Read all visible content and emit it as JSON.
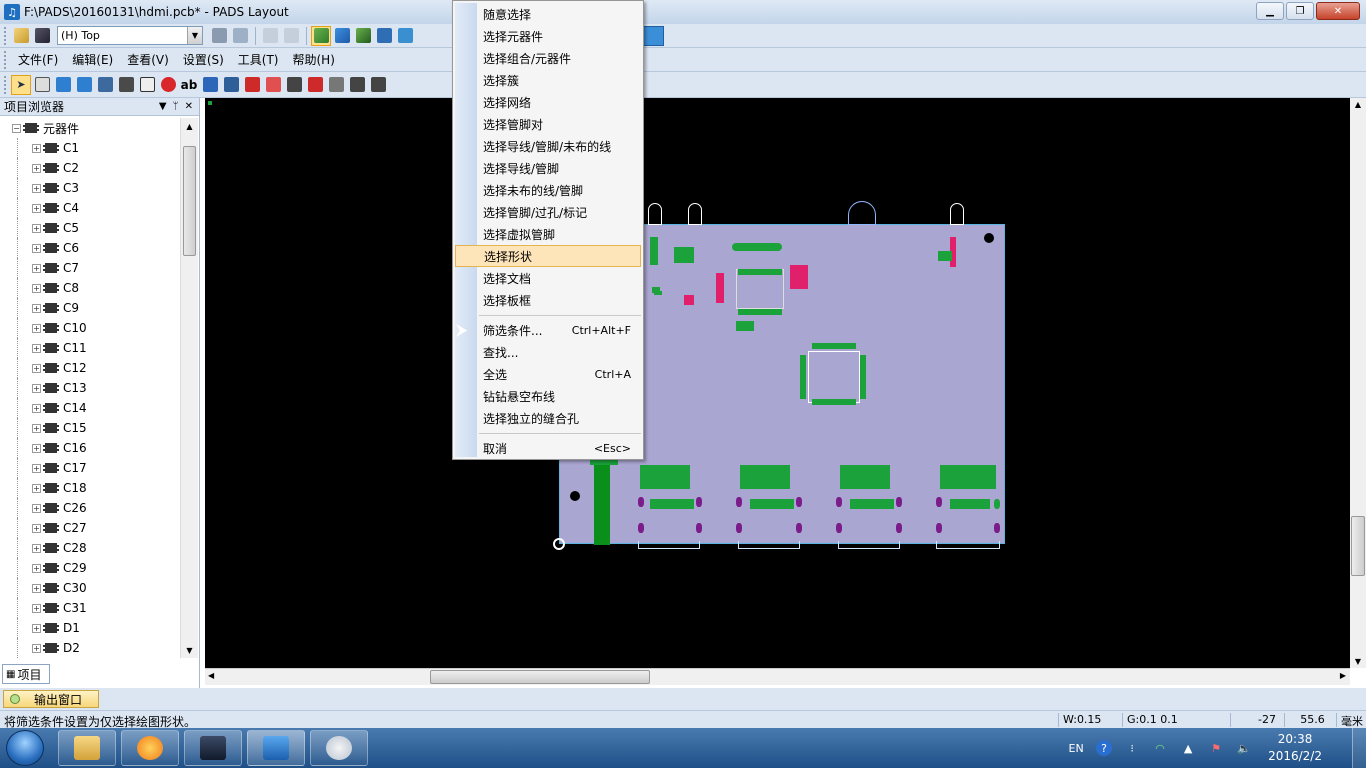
{
  "window": {
    "title": "F:\\PADS\\20160131\\hdmi.pcb* - PADS Layout",
    "minimize": "▁",
    "restore": "❐",
    "close": "✕"
  },
  "toolbar": {
    "layer_select": "(H) Top"
  },
  "menu": [
    "文件(F)",
    "编辑(E)",
    "查看(V)",
    "设置(S)",
    "工具(T)",
    "帮助(H)"
  ],
  "project_browser": {
    "title": "项目浏览器",
    "root": "元器件",
    "items": [
      "C1",
      "C2",
      "C3",
      "C4",
      "C5",
      "C6",
      "C7",
      "C8",
      "C9",
      "C10",
      "C11",
      "C12",
      "C13",
      "C14",
      "C15",
      "C16",
      "C17",
      "C18",
      "C26",
      "C27",
      "C28",
      "C29",
      "C30",
      "C31",
      "D1",
      "D2"
    ],
    "tab": "项目"
  },
  "context_menu": {
    "items": [
      {
        "label": "随意选择"
      },
      {
        "label": "选择元器件"
      },
      {
        "label": "选择组合/元器件"
      },
      {
        "label": "选择簇"
      },
      {
        "label": "选择网络"
      },
      {
        "label": "选择管脚对"
      },
      {
        "label": "选择导线/管脚/未布的线"
      },
      {
        "label": "选择导线/管脚"
      },
      {
        "label": "选择未布的线/管脚"
      },
      {
        "label": "选择管脚/过孔/标记"
      },
      {
        "label": "选择虚拟管脚"
      },
      {
        "label": "选择形状",
        "highlighted": true
      },
      {
        "label": "选择文档"
      },
      {
        "label": "选择板框"
      }
    ],
    "items2": [
      {
        "label": "筛选条件...",
        "shortcut": "Ctrl+Alt+F"
      },
      {
        "label": "查找..."
      },
      {
        "label": "全选",
        "shortcut": "Ctrl+A"
      },
      {
        "label": "钻钻悬空布线"
      },
      {
        "label": "选择独立的缝合孔"
      }
    ],
    "items3": [
      {
        "label": "取消",
        "shortcut": "<Esc>"
      }
    ]
  },
  "output_tab": "输出窗口",
  "status": {
    "message": "将筛选条件设置为仅选择绘图形状。",
    "width": "W:0.15",
    "grid": "G:0.1 0.1",
    "x": "-27",
    "y": "55.6",
    "unit": "毫米"
  },
  "taskbar": {
    "lang": "EN",
    "time": "20:38",
    "date": "2016/2/2"
  },
  "colors": {
    "canvas": "#000000",
    "board": "#aaa6d2",
    "highlight": "#fde4b9",
    "trace_green": "#0b8f1b"
  }
}
